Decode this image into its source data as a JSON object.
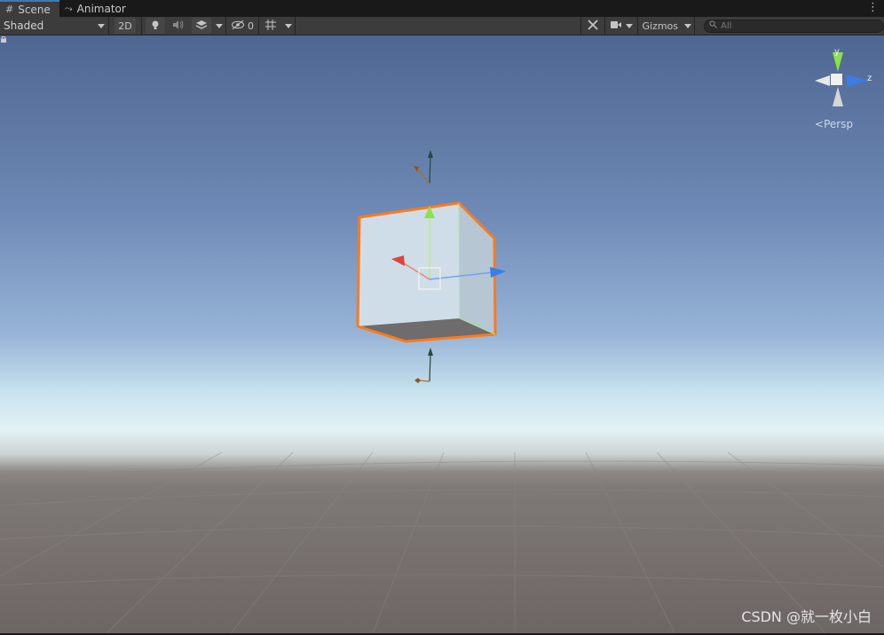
{
  "tabs": [
    {
      "label": "Scene",
      "icon": "grid-icon",
      "active": true
    },
    {
      "label": "Animator",
      "icon": "animator-icon",
      "active": false
    }
  ],
  "toolbar": {
    "shading_mode": "Shaded",
    "mode_2d": "2D",
    "hidden_count": "0",
    "gizmos_label": "Gizmos",
    "search_placeholder": "All"
  },
  "scene_gizmo": {
    "y_label": "y",
    "z_label": "z",
    "projection_label": "Persp"
  },
  "watermark": "CSDN @就一枚小白",
  "colors": {
    "selection_outline": "#ff7a1a",
    "axis_x": "#e0443a",
    "axis_y": "#8ae34a",
    "axis_z": "#3c7be8",
    "sky": "#6f8ab6",
    "ground": "#6d6664"
  }
}
